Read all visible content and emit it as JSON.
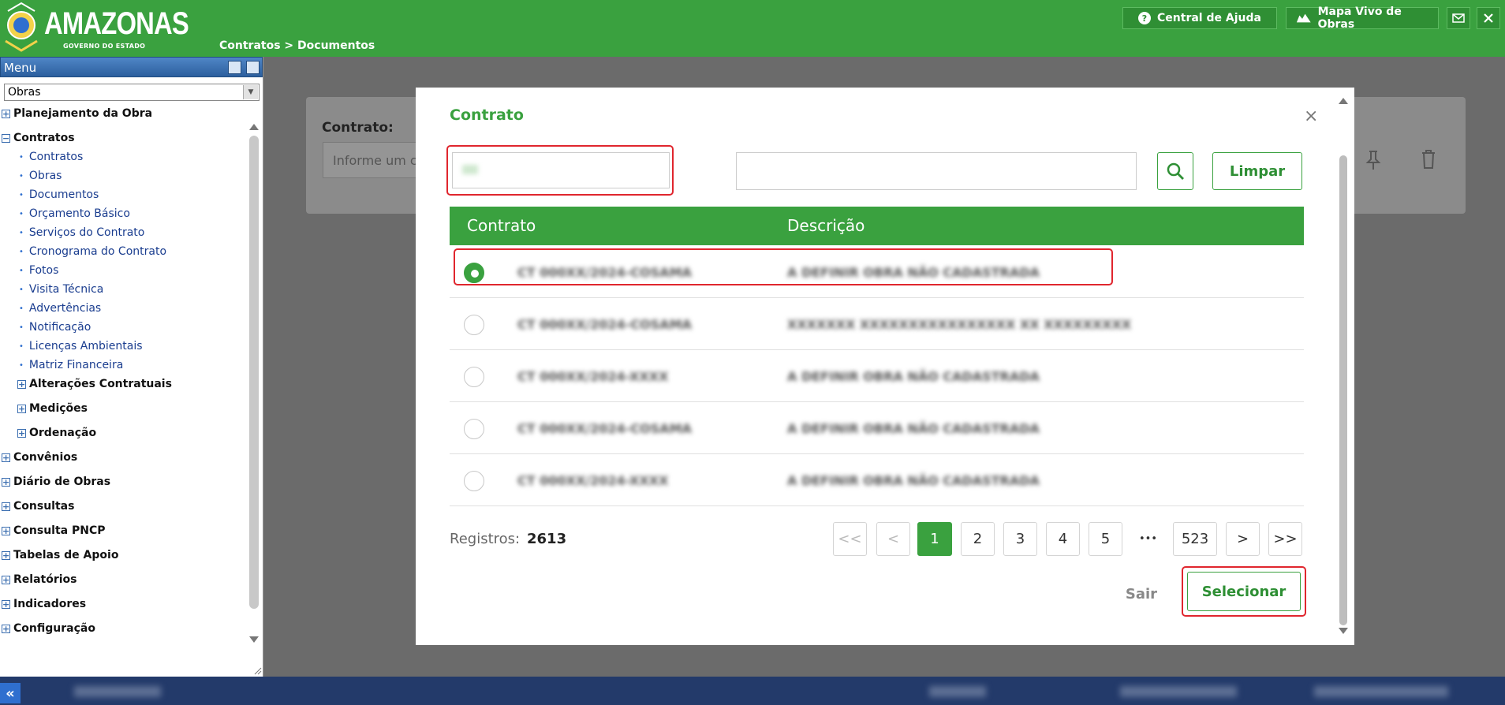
{
  "header": {
    "logo_text": "AMAZONAS",
    "logo_sub": "GOVERNO DO ESTADO",
    "breadcrumb": "Contratos > Documentos",
    "help_label": "Central de Ajuda",
    "map_label": "Mapa Vivo de Obras"
  },
  "sidebar": {
    "title": "Menu",
    "module_select": "Obras",
    "items": [
      {
        "label": "Planejamento da Obra",
        "expander": "+"
      },
      {
        "label": "Contratos",
        "expander": "−"
      },
      {
        "label": "Contratos"
      },
      {
        "label": "Obras"
      },
      {
        "label": "Documentos"
      },
      {
        "label": "Orçamento Básico"
      },
      {
        "label": "Serviços do Contrato"
      },
      {
        "label": "Cronograma do Contrato"
      },
      {
        "label": "Fotos"
      },
      {
        "label": "Visita Técnica"
      },
      {
        "label": "Advertências"
      },
      {
        "label": "Notificação"
      },
      {
        "label": "Licenças Ambientais"
      },
      {
        "label": "Matriz Financeira"
      },
      {
        "label": "Alterações Contratuais",
        "expander": "+"
      },
      {
        "label": "Medições",
        "expander": "+"
      },
      {
        "label": "Ordenação",
        "expander": "+"
      },
      {
        "label": "Convênios",
        "expander": "+"
      },
      {
        "label": "Diário de Obras",
        "expander": "+"
      },
      {
        "label": "Consultas",
        "expander": "+"
      },
      {
        "label": "Consulta PNCP",
        "expander": "+"
      },
      {
        "label": "Tabelas de Apoio",
        "expander": "+"
      },
      {
        "label": "Relatórios",
        "expander": "+"
      },
      {
        "label": "Indicadores",
        "expander": "+"
      },
      {
        "label": "Configuração",
        "expander": "+"
      }
    ]
  },
  "background": {
    "label": "Contrato:",
    "placeholder": "Informe um co"
  },
  "modal": {
    "title": "Contrato",
    "close": "×",
    "clear_label": "Limpar",
    "columns": [
      "Contrato",
      "Descrição"
    ],
    "rows": [
      {
        "contrato": "CT 000XX/2024-COSAMA",
        "descricao": "A DEFINIR OBRA NÃO CADASTRADA",
        "selected": true
      },
      {
        "contrato": "CT 000XX/2024-COSAMA",
        "descricao": "XXXXXXX XXXXXXXXXXXXXXXX XX XXXXXXXXX",
        "selected": false
      },
      {
        "contrato": "CT 000XX/2024-XXXX",
        "descricao": "A DEFINIR OBRA NÃO CADASTRADA",
        "selected": false
      },
      {
        "contrato": "CT 000XX/2024-COSAMA",
        "descricao": "A DEFINIR OBRA NÃO CADASTRADA",
        "selected": false
      },
      {
        "contrato": "CT 000XX/2024-XXXX",
        "descricao": "A DEFINIR OBRA NÃO CADASTRADA",
        "selected": false
      }
    ],
    "records_label": "Registros:",
    "records_count": "2613",
    "pagination": {
      "first": "<<",
      "prev": "<",
      "pages": [
        "1",
        "2",
        "3",
        "4",
        "5"
      ],
      "ellipsis": "•••",
      "last_page": "523",
      "next": ">",
      "last": ">>"
    },
    "exit_label": "Sair",
    "select_label": "Selecionar"
  },
  "colors": {
    "brand_green": "#3aa13f",
    "highlight_red": "#e0262e",
    "taskbar": "#233a6a"
  }
}
